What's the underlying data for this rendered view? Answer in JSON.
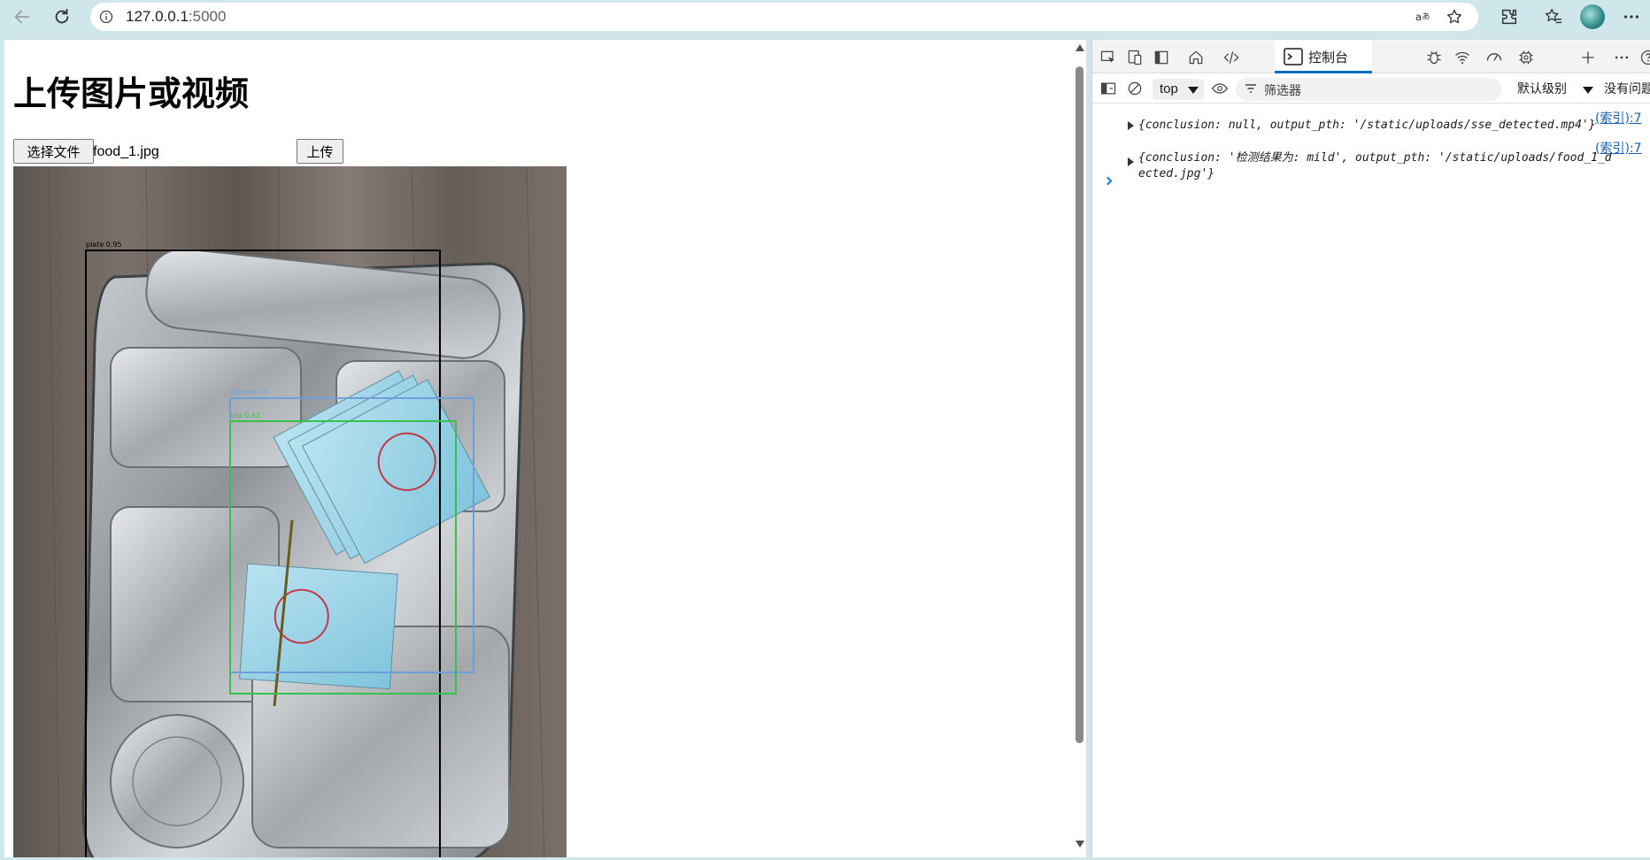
{
  "browser": {
    "url_host": "127.0.0.1",
    "url_port": ":5000"
  },
  "page": {
    "title": "上传图片或视频",
    "file_button_label": "选择文件",
    "file_name": "food_1.jpg",
    "upload_button_label": "上传",
    "image": {
      "alt": "Detected food tray image",
      "detections": [
        {
          "label": "plate 0.95",
          "color": "#000000"
        },
        {
          "label": "ticket 0.77",
          "color": "#6f9fd8"
        },
        {
          "label": "slip 0.62",
          "color": "#35c24a"
        }
      ]
    }
  },
  "devtools": {
    "active_tab": "控制台",
    "context": "top",
    "filter_placeholder": "筛选器",
    "level": "默认级别",
    "issues": "没有问题",
    "logs": [
      {
        "source": "(索引):7",
        "text_line1": "{conclusion: null, output_pth: '/static/uploads/sse_detected.mp4'}",
        "text_line2": ""
      },
      {
        "source": "(索引):7",
        "text_line1": "{conclusion: '检测结果为: mild', output_pth: '/static/uploads/food_1_d",
        "text_line2": "ected.jpg'}"
      }
    ]
  },
  "colors": {
    "chrome_bg": "#cfe6ea",
    "accent": "#0f6cbd",
    "link": "#1a5fb4"
  }
}
